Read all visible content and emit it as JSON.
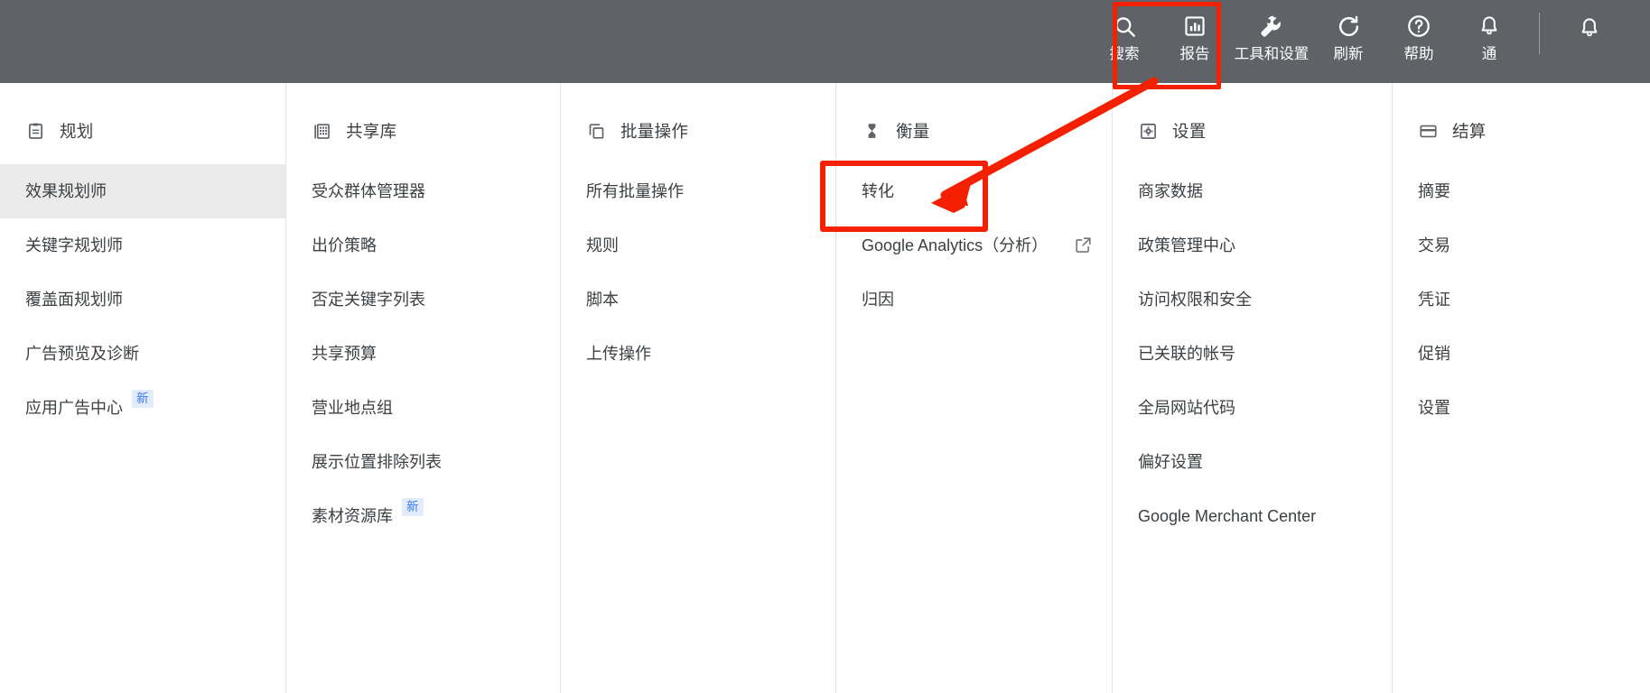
{
  "topbar": {
    "background_color": "#5f6368",
    "items": [
      {
        "label": "搜索",
        "icon": "search-icon",
        "name": "toolbar-search"
      },
      {
        "label": "报告",
        "icon": "report-icon",
        "name": "toolbar-reports"
      },
      {
        "label": "工具和设置",
        "icon": "tools-wrench-icon",
        "name": "toolbar-tools-and-settings",
        "highlighted": true
      },
      {
        "label": "刷新",
        "icon": "refresh-icon",
        "name": "toolbar-refresh"
      },
      {
        "label": "帮助",
        "icon": "help-icon",
        "name": "toolbar-help"
      },
      {
        "label": "通",
        "icon": "bell-icon",
        "name": "toolbar-notifications"
      }
    ],
    "trailing_icon": {
      "label": "",
      "icon": "bell-icon",
      "name": "toolbar-notifications-secondary"
    }
  },
  "annotations": {
    "highlight_color": "#f52000",
    "boxes": [
      {
        "name": "tools-and-settings-highlight",
        "target": "工具和设置"
      },
      {
        "name": "conversions-highlight",
        "target": "转化"
      }
    ],
    "arrow": {
      "name": "pointer-arrow",
      "from": "工具和设置",
      "to": "转化"
    }
  },
  "menu": {
    "columns": [
      {
        "id": "planning",
        "icon": "clipboard-icon",
        "title": "规划",
        "items": [
          {
            "label": "效果规划师",
            "selected": true
          },
          {
            "label": "关键字规划师"
          },
          {
            "label": "覆盖面规划师"
          },
          {
            "label": "广告预览及诊断"
          },
          {
            "label": "应用广告中心",
            "badge": "新"
          }
        ]
      },
      {
        "id": "shared-library",
        "icon": "library-grid-icon",
        "title": "共享库",
        "items": [
          {
            "label": "受众群体管理器"
          },
          {
            "label": "出价策略"
          },
          {
            "label": "否定关键字列表"
          },
          {
            "label": "共享预算"
          },
          {
            "label": "营业地点组"
          },
          {
            "label": "展示位置排除列表"
          },
          {
            "label": "素材资源库",
            "badge": "新"
          }
        ]
      },
      {
        "id": "bulk-actions",
        "icon": "copy-stack-icon",
        "title": "批量操作",
        "items": [
          {
            "label": "所有批量操作"
          },
          {
            "label": "规则"
          },
          {
            "label": "脚本"
          },
          {
            "label": "上传操作"
          }
        ]
      },
      {
        "id": "measurement",
        "icon": "hourglass-icon",
        "title": "衡量",
        "items": [
          {
            "label": "转化",
            "highlighted": true
          },
          {
            "label": "Google Analytics（分析）",
            "external": true
          },
          {
            "label": "归因"
          }
        ]
      },
      {
        "id": "setup",
        "icon": "gear-square-icon",
        "title": "设置",
        "items": [
          {
            "label": "商家数据"
          },
          {
            "label": "政策管理中心"
          },
          {
            "label": "访问权限和安全"
          },
          {
            "label": "已关联的帐号"
          },
          {
            "label": "全局网站代码"
          },
          {
            "label": "偏好设置"
          },
          {
            "label": "Google Merchant Center"
          }
        ]
      },
      {
        "id": "billing",
        "icon": "credit-card-icon",
        "title": "结算",
        "items": [
          {
            "label": "摘要"
          },
          {
            "label": "交易"
          },
          {
            "label": "凭证"
          },
          {
            "label": "促销"
          },
          {
            "label": "设置"
          }
        ]
      }
    ]
  }
}
